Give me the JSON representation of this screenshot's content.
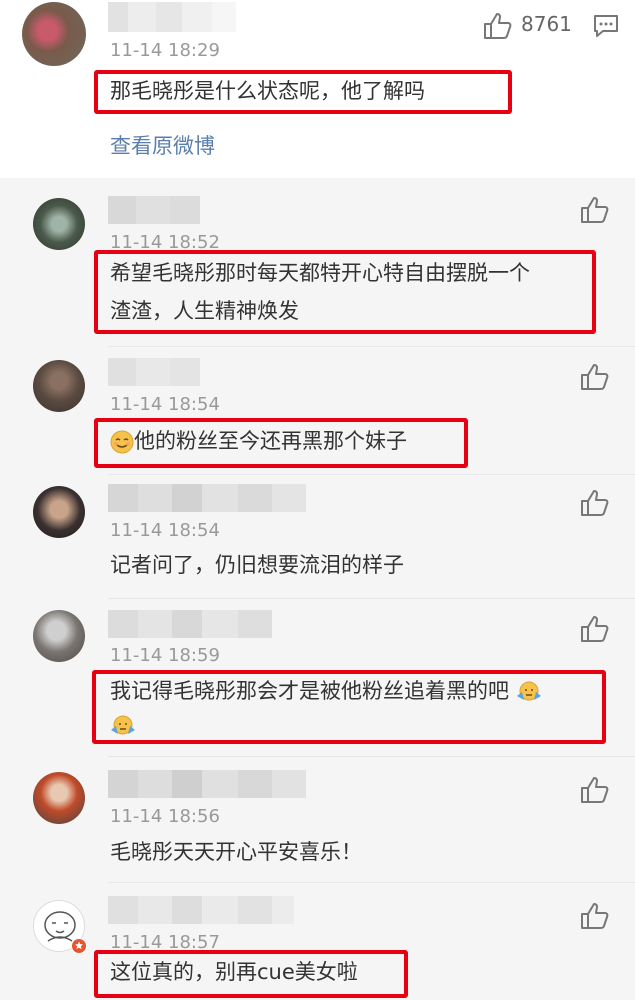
{
  "main": {
    "timestamp": "11-14 18:29",
    "text": "那毛晓彤是什么状态呢，他了解吗",
    "like_count": "8761",
    "view_original": "查看原微博"
  },
  "replies": [
    {
      "timestamp": "11-14 18:52",
      "line1": "希望毛晓彤那时每天都特开心特自由摆脱一个",
      "line2": "渣渣，人生精神焕发"
    },
    {
      "timestamp": "11-14 18:54",
      "text": "他的粉丝至今还再黑那个妹子",
      "emoji": "smiling-emoji"
    },
    {
      "timestamp": "11-14 18:54",
      "text": "记者问了，仍旧想要流泪的样子"
    },
    {
      "timestamp": "11-14 18:59",
      "text": "我记得毛晓彤那会才是被他粉丝追着黑的吧",
      "emoji": "shrug-emoji"
    },
    {
      "timestamp": "11-14 18:56",
      "text": "毛晓彤天天开心平安喜乐！"
    },
    {
      "timestamp": "11-14 18:57",
      "text": "这位真的，别再cue美女啦"
    }
  ],
  "colors": {
    "highlight": "#e60012",
    "link": "#5b7fad",
    "reply_bg": "#f5f5f5"
  },
  "icons": [
    "thumbs-up-icon",
    "comment-icon"
  ]
}
